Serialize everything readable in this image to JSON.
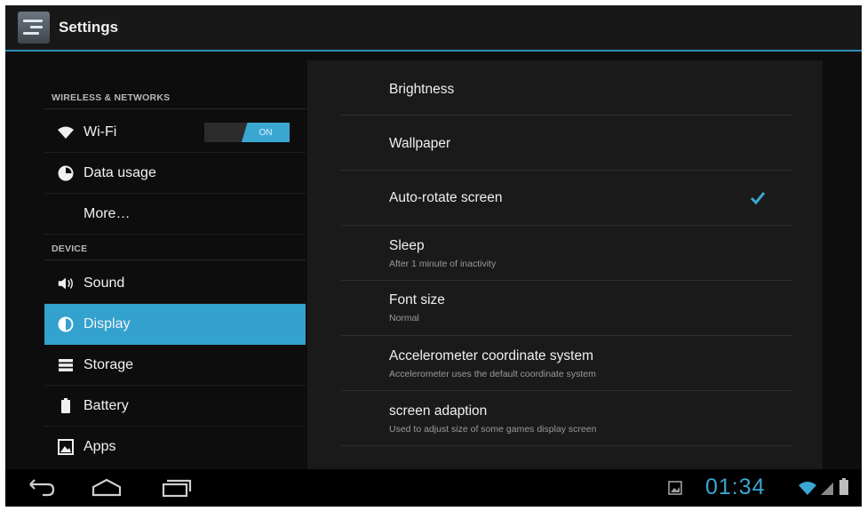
{
  "actionbar": {
    "title": "Settings"
  },
  "left_nav": {
    "categories": [
      {
        "label": "WIRELESS & NETWORKS"
      },
      {
        "label": "DEVICE"
      }
    ],
    "items": [
      {
        "label": "Wi-Fi",
        "icon": "wifi-icon",
        "toggle": "ON"
      },
      {
        "label": "Data usage",
        "icon": "data-usage-icon"
      },
      {
        "label": "More…"
      },
      {
        "label": "Sound",
        "icon": "speaker-icon"
      },
      {
        "label": "Display",
        "icon": "display-icon",
        "selected": true
      },
      {
        "label": "Storage",
        "icon": "storage-icon"
      },
      {
        "label": "Battery",
        "icon": "battery-icon"
      },
      {
        "label": "Apps",
        "icon": "apps-icon"
      }
    ]
  },
  "display_settings": [
    {
      "title": "Brightness"
    },
    {
      "title": "Wallpaper"
    },
    {
      "title": "Auto-rotate screen",
      "checked": true
    },
    {
      "title": "Sleep",
      "summary": "After 1 minute of inactivity"
    },
    {
      "title": "Font size",
      "summary": "Normal"
    },
    {
      "title": "Accelerometer coordinate system",
      "summary": "Accelerometer uses the default coordinate system"
    },
    {
      "title": "screen adaption",
      "summary": "Used to adjust size of some games display screen"
    }
  ],
  "status_bar": {
    "time": "01:34"
  },
  "colors": {
    "accent": "#33a2cf",
    "background": "#0d0d0d",
    "panel": "#1a1a1a"
  }
}
